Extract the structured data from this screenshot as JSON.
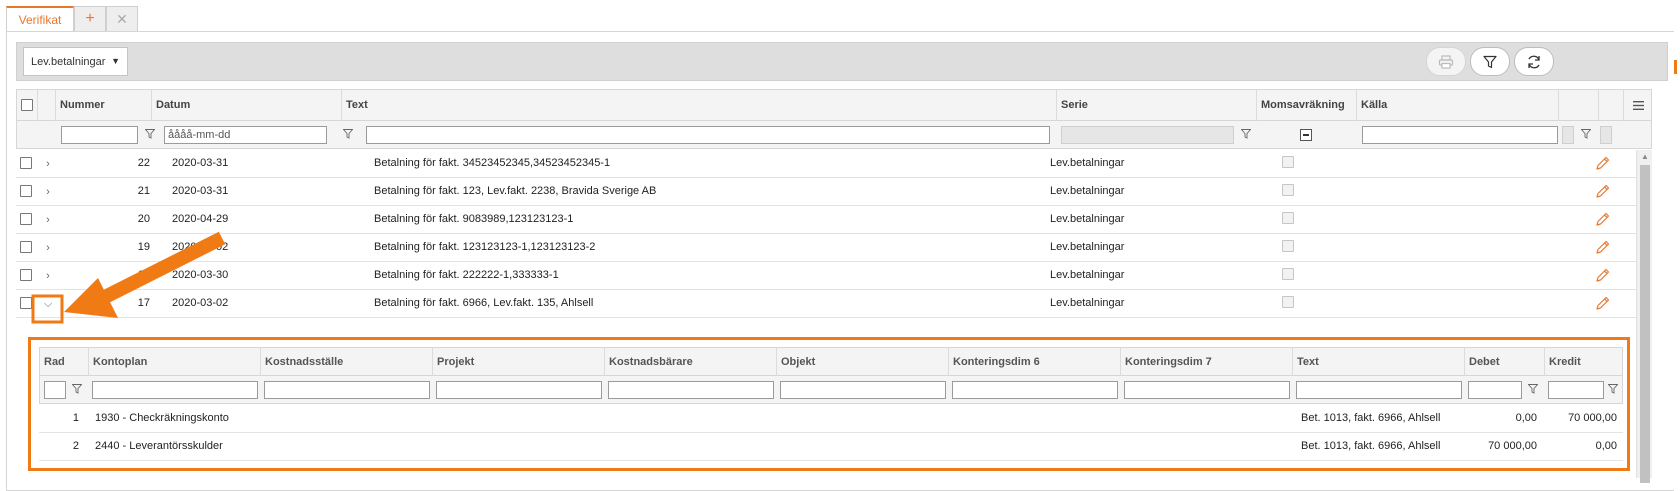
{
  "tabs": {
    "active": "Verifikat",
    "add": "+",
    "close": "✕"
  },
  "toolbar": {
    "series_select": "Lev.betalningar",
    "buttons": [
      "print-icon",
      "filter-icon",
      "refresh-icon"
    ]
  },
  "grid": {
    "columns": [
      "Nummer",
      "Datum",
      "Text",
      "Serie",
      "Momsavräkning",
      "Källa"
    ],
    "date_placeholder": "åååå-mm-dd",
    "rows": [
      {
        "nummer": "22",
        "datum": "2020-03-31",
        "text": "Betalning för fakt. 34523452345,34523452345-1",
        "serie": "Lev.betalningar"
      },
      {
        "nummer": "21",
        "datum": "2020-03-31",
        "text": "Betalning för fakt. 123, Lev.fakt. 2238, Bravida Sverige AB",
        "serie": "Lev.betalningar"
      },
      {
        "nummer": "20",
        "datum": "2020-04-29",
        "text": "Betalning för fakt. 9083989,123123123-1",
        "serie": "Lev.betalningar"
      },
      {
        "nummer": "19",
        "datum": "2020-04-02",
        "text": "Betalning för fakt. 123123123-1,123123123-2",
        "serie": "Lev.betalningar"
      },
      {
        "nummer": "18",
        "datum": "2020-03-30",
        "text": "Betalning för fakt. 222222-1,333333-1",
        "serie": "Lev.betalningar"
      },
      {
        "nummer": "17",
        "datum": "2020-03-02",
        "text": "Betalning för fakt. 6966, Lev.fakt. 135, Ahlsell",
        "serie": "Lev.betalningar"
      }
    ]
  },
  "subgrid": {
    "columns": [
      "Rad",
      "Kontoplan",
      "Kostnadsställe",
      "Projekt",
      "Kostnadsbärare",
      "Objekt",
      "Konteringsdim 6",
      "Konteringsdim 7",
      "Text",
      "Debet",
      "Kredit"
    ],
    "rows": [
      {
        "rad": "1",
        "kontoplan": "1930 - Checkräkningskonto",
        "text": "Bet. 1013, fakt. 6966, Ahlsell",
        "debet": "0,00",
        "kredit": "70 000,00"
      },
      {
        "rad": "2",
        "kontoplan": "2440 - Leverantörsskulder",
        "text": "Bet. 1013, fakt. 6966, Ahlsell",
        "debet": "70 000,00",
        "kredit": "0,00"
      }
    ]
  },
  "colors": {
    "accent": "#e8772e",
    "highlight": "#f07a14"
  }
}
